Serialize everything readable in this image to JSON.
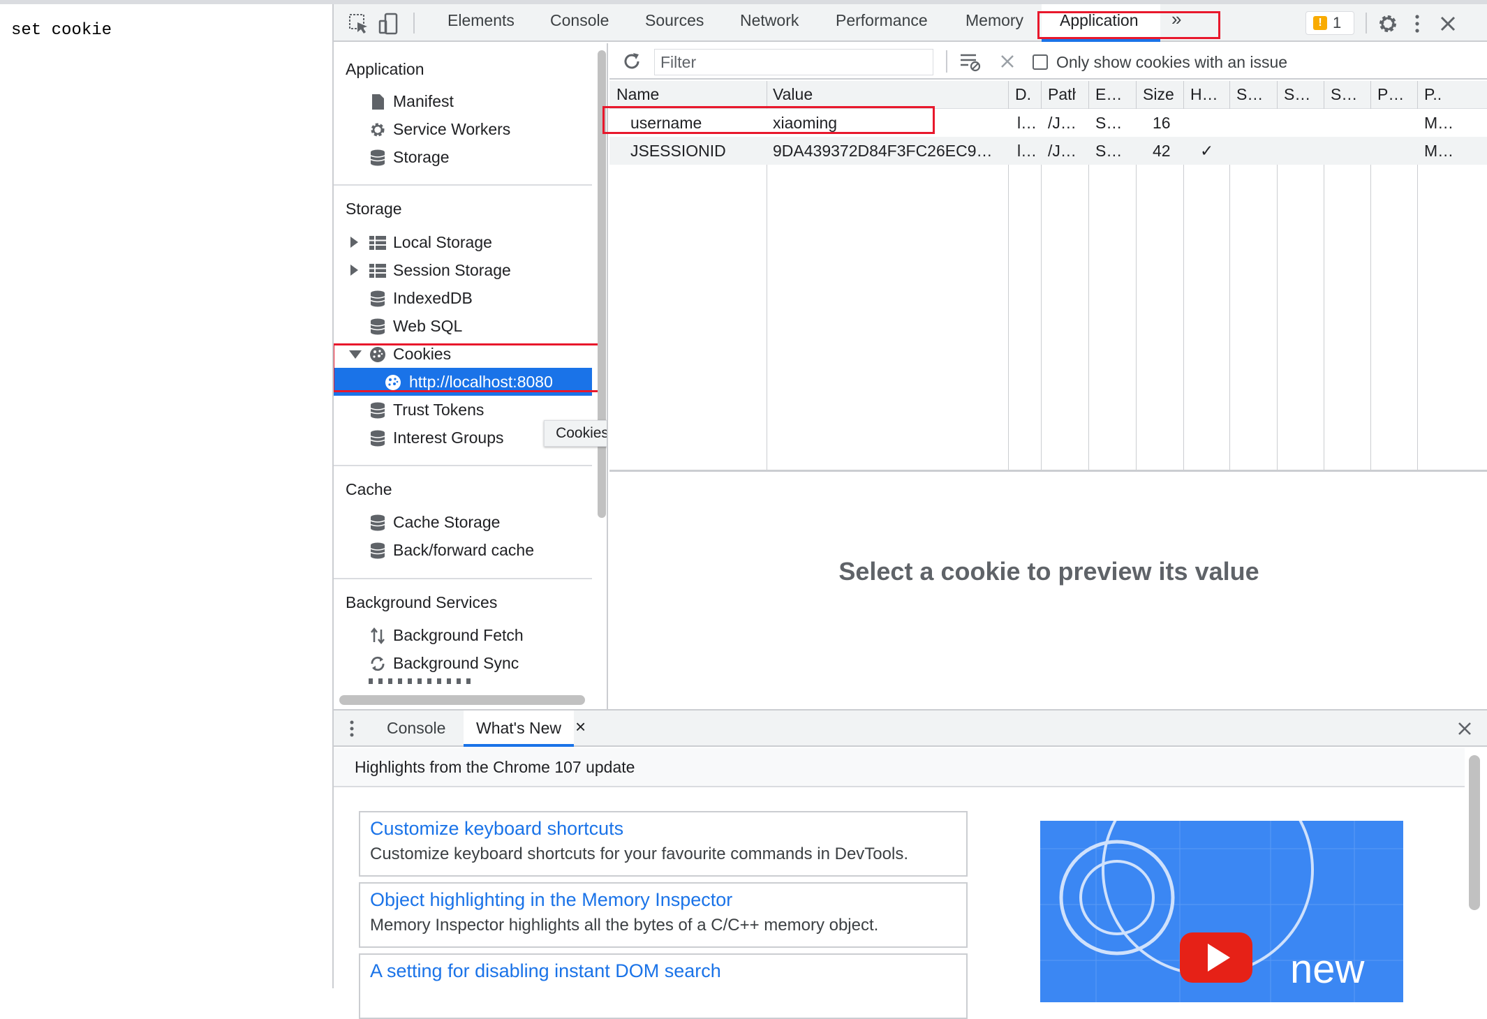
{
  "page": {
    "text": "set cookie"
  },
  "devtools": {
    "tabs": [
      "Elements",
      "Console",
      "Sources",
      "Network",
      "Performance",
      "Memory",
      "Application"
    ],
    "more_tabs_icon": "chevron-double-right-icon",
    "issues_count": "1",
    "icons": {
      "inspect": "inspect-element-icon",
      "device": "device-toolbar-icon",
      "settings": "gear-icon",
      "more": "kebab-menu-icon",
      "close": "close-icon",
      "issues": "warning-icon"
    },
    "highlight_color": "#e8182c",
    "accent_color": "#1a73e8"
  },
  "sidebar": {
    "sections": [
      {
        "title": "Application",
        "items": [
          {
            "label": "Manifest",
            "icon": "document-icon"
          },
          {
            "label": "Service Workers",
            "icon": "gear-icon"
          },
          {
            "label": "Storage",
            "icon": "database-icon"
          }
        ]
      },
      {
        "title": "Storage",
        "items": [
          {
            "label": "Local Storage",
            "icon": "table-icon"
          },
          {
            "label": "Session Storage",
            "icon": "table-icon"
          },
          {
            "label": "IndexedDB",
            "icon": "database-icon"
          },
          {
            "label": "Web SQL",
            "icon": "database-icon"
          },
          {
            "label": "Cookies",
            "icon": "cookie-icon"
          },
          {
            "label": "http://localhost:8080",
            "icon": "cookie-icon"
          },
          {
            "label": "Trust Tokens",
            "icon": "database-icon"
          },
          {
            "label": "Interest Groups",
            "icon": "database-icon"
          }
        ]
      },
      {
        "title": "Cache",
        "items": [
          {
            "label": "Cache Storage",
            "icon": "database-icon"
          },
          {
            "label": "Back/forward cache",
            "icon": "database-icon"
          }
        ]
      },
      {
        "title": "Background Services",
        "items": [
          {
            "label": "Background Fetch",
            "icon": "arrows-updown-icon"
          },
          {
            "label": "Background Sync",
            "icon": "sync-icon"
          }
        ]
      }
    ],
    "tooltip": "Cookies"
  },
  "cookies": {
    "filter_placeholder": "Filter",
    "only_issue_label": "Only show cookies with an issue",
    "columns": [
      "Name",
      "Value",
      "D.",
      "Path",
      "E…",
      "Size",
      "H…",
      "S…",
      "S…",
      "S…",
      "P…",
      "P.."
    ],
    "rows": [
      {
        "name": "username",
        "value": "xiaoming",
        "domain": "l…",
        "path": "/J…",
        "expires": "S…",
        "size": "16",
        "httponly": "",
        "priority": "M…"
      },
      {
        "name": "JSESSIONID",
        "value": "9DA439372D84F3FC26EC9…",
        "domain": "l…",
        "path": "/J…",
        "expires": "S…",
        "size": "42",
        "httponly": "✓",
        "priority": "M…"
      }
    ],
    "preview_placeholder": "Select a cookie to preview its value"
  },
  "drawer": {
    "tabs": [
      "Console",
      "What's New"
    ],
    "header": "Highlights from the Chrome 107 update",
    "cards": [
      {
        "title": "Customize keyboard shortcuts",
        "desc": "Customize keyboard shortcuts for your favourite commands in DevTools."
      },
      {
        "title": "Object highlighting in the Memory Inspector",
        "desc": "Memory Inspector highlights all the bytes of a C/C++ memory object."
      },
      {
        "title": "A setting for disabling instant DOM search",
        "desc": ""
      }
    ],
    "video_text": "new"
  }
}
